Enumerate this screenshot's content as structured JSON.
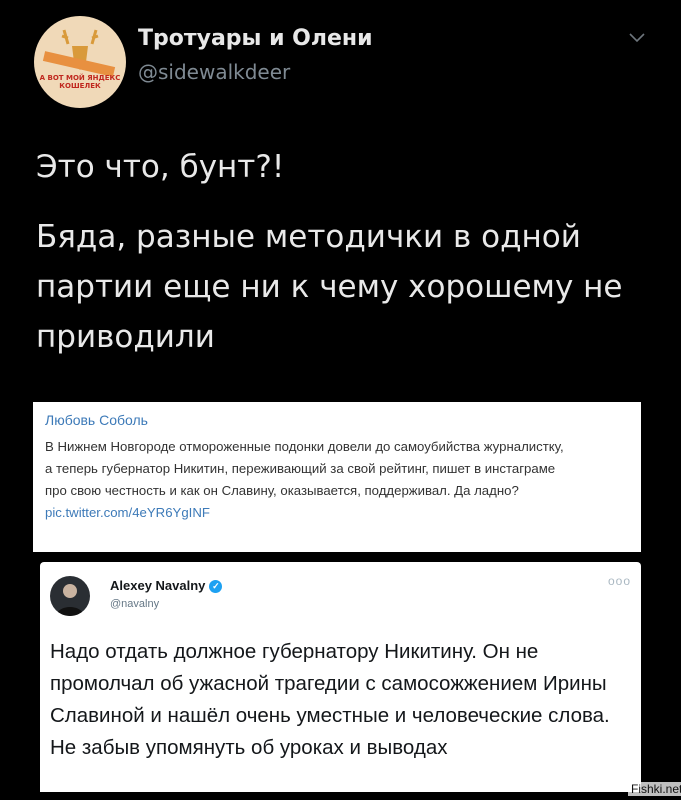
{
  "header": {
    "display_name": "Тротуары и Олени",
    "handle": "@sidewalkdeer",
    "avatar_caption": "А ВОТ МОЙ ЯНДЕКС КОШЕЛЕК"
  },
  "tweet": {
    "line1": "Это что, бунт?!",
    "line2": "Бяда, разные методички в одной партии еще ни к чему хорошему не приводили"
  },
  "quoted_post_1": {
    "author": "Любовь Соболь",
    "text": "В Нижнем Новгороде отмороженные подонки довели до самоубийства журналистку, а теперь губернатор Никитин, переживающий за свой рейтинг, пишет в инстаграме про свою честность и как он Славину, оказывается, поддерживал. Да ладно?",
    "link": "pic.twitter.com/4eYR6YgINF"
  },
  "quoted_post_2": {
    "author": "Alexey Navalny",
    "handle": "@navalny",
    "more": "ooo",
    "text": "Надо отдать должное губернатору Никитину. Он не промолчал об ужасной трагедии с самосожжением Ирины Славиной и нашёл очень уместные и человеческие слова. Не забыв упомянуть об уроках и выводах"
  },
  "watermark": "Fishki.net",
  "colors": {
    "background": "#000000",
    "handle_gray": "#7f8a93",
    "link_blue": "#3d7ab8",
    "verified_blue": "#1da1f2"
  }
}
